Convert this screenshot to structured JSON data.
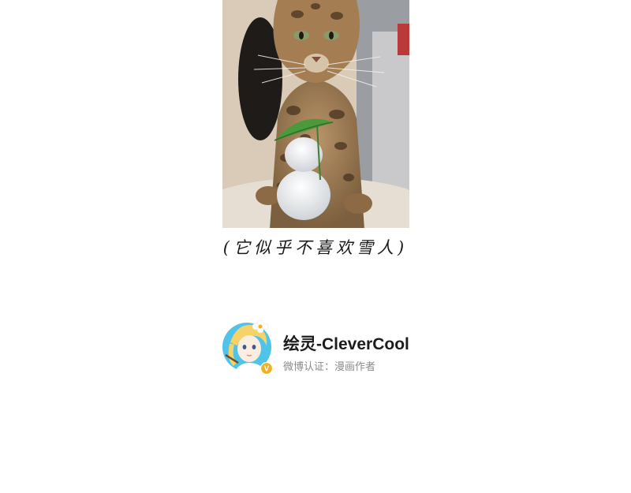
{
  "photo": {
    "subject": "bengal-cat-with-snowman"
  },
  "caption": {
    "text": "(它似乎不喜欢雪人)"
  },
  "author": {
    "name": "绘灵-CleverCool",
    "verification": "微博认证：漫画作者",
    "badge": "V",
    "badge_color": "#f2b01e",
    "avatar_bg": "#4fc3e8"
  }
}
